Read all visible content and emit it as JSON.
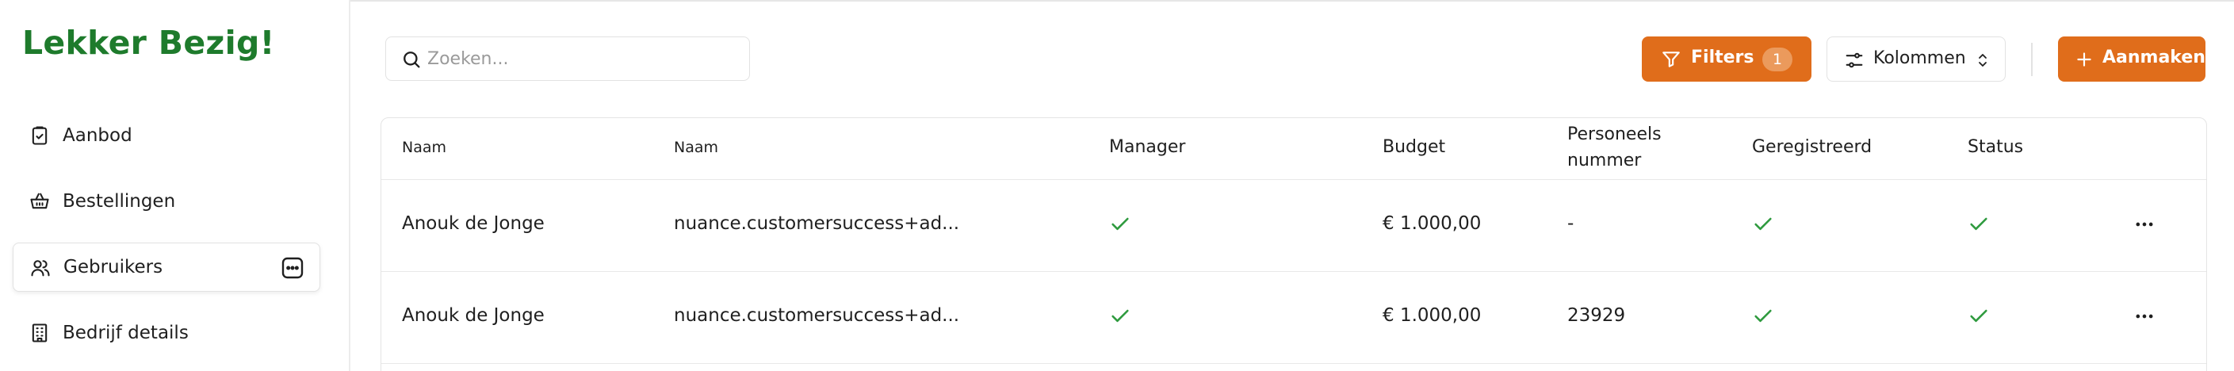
{
  "app": {
    "logo": "Lekker Bezig!"
  },
  "sidebar": {
    "items": [
      {
        "label": "Aanbod",
        "icon": "clipboard-check-icon"
      },
      {
        "label": "Bestellingen",
        "icon": "basket-icon"
      },
      {
        "label": "Gebruikers",
        "icon": "users-icon",
        "active": true
      },
      {
        "label": "Bedrijf details",
        "icon": "building-icon"
      }
    ]
  },
  "toolbar": {
    "search_placeholder": "Zoeken...",
    "filters_label": "Filters",
    "filters_count": "1",
    "kolommen_label": "Kolommen",
    "aanmaken_label": "Aanmaken",
    "accent_color": "#e06d1b"
  },
  "table": {
    "headers": [
      "Naam",
      "Naam",
      "Manager",
      "Budget",
      "Personeels",
      "nummer",
      "Geregistreerd",
      "Status"
    ],
    "rows": [
      {
        "naam": "Anouk de Jonge",
        "email": "nuance.customersuccess+ad...",
        "manager": true,
        "budget": "€ 1.000,00",
        "personeelsnummer": "-",
        "geregistreerd": true,
        "status": true
      },
      {
        "naam": "Anouk de Jonge",
        "email": "nuance.customersuccess+ad...",
        "manager": true,
        "budget": "€ 1.000,00",
        "personeelsnummer": "23929",
        "geregistreerd": true,
        "status": true
      }
    ],
    "check_color": "#2e9a3e"
  }
}
